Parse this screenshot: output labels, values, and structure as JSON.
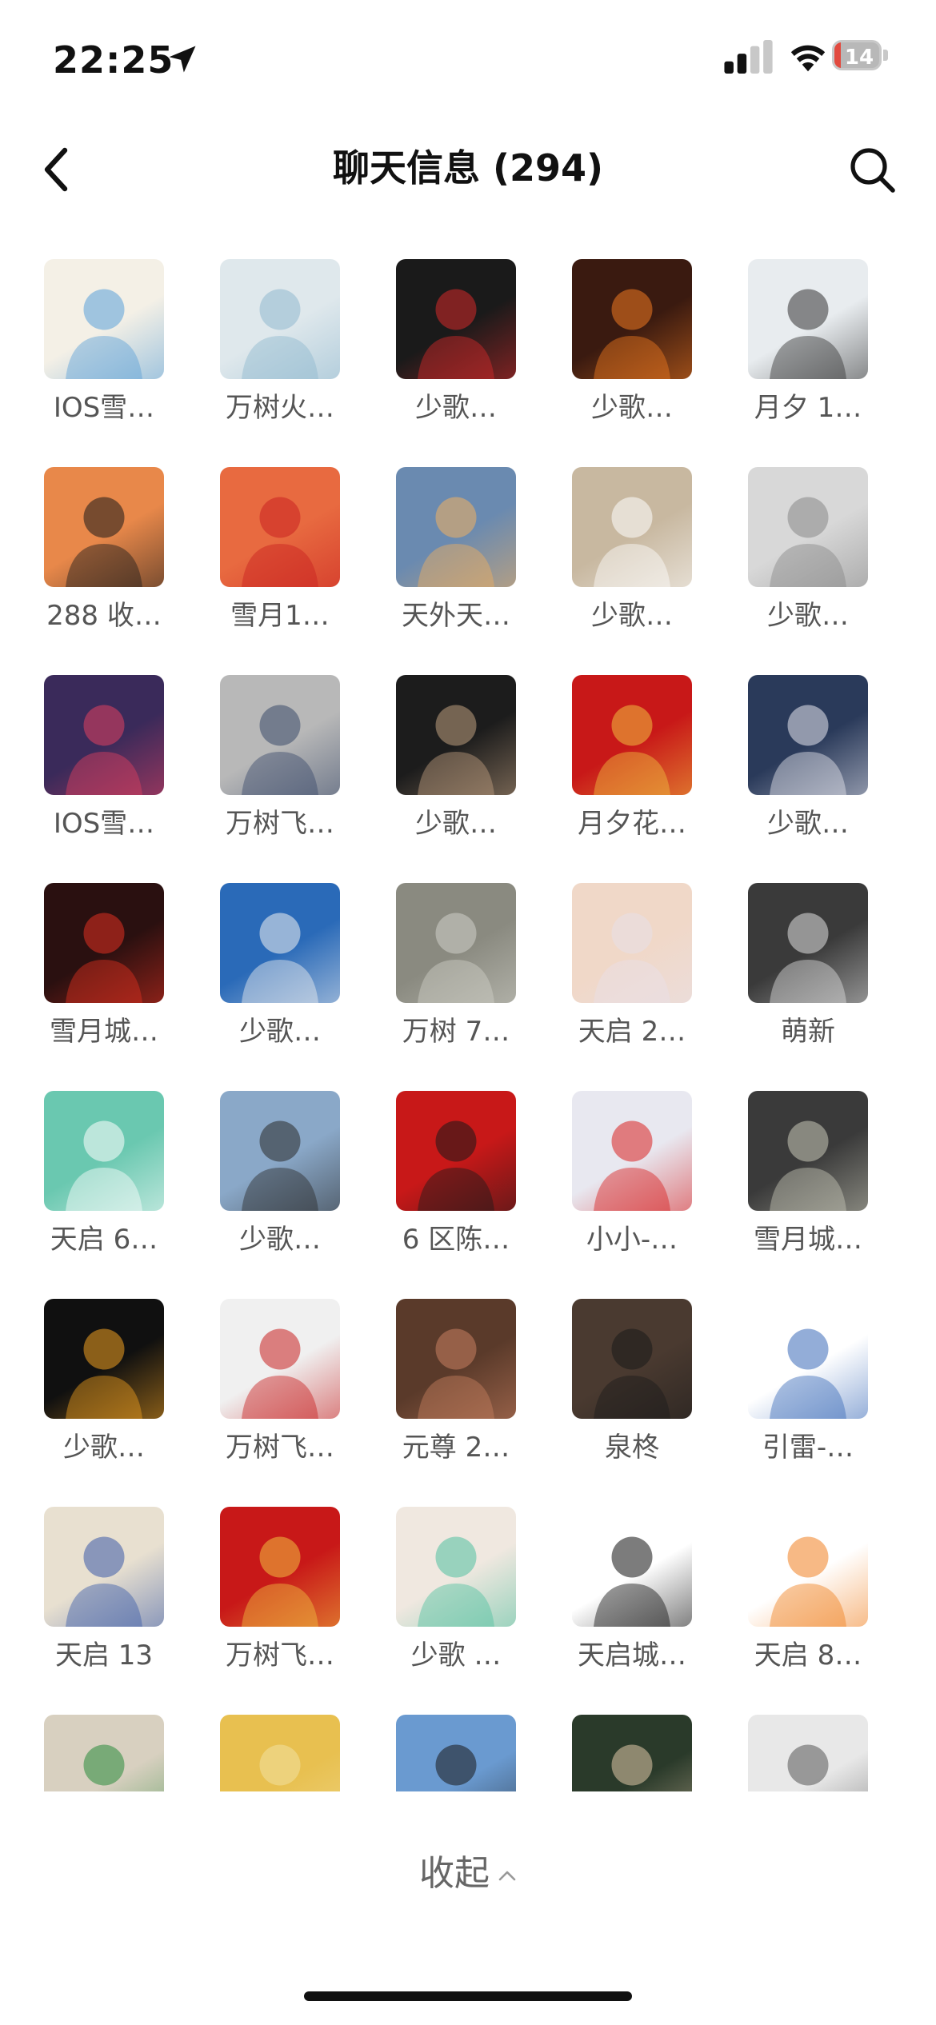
{
  "status": {
    "time": "22:25",
    "battery": "14",
    "battery_level": 0.14,
    "battery_color": "#e24a3f"
  },
  "nav": {
    "title": "聊天信息 (294)"
  },
  "members": [
    {
      "name": "IOS雪…",
      "color": "#f4f0e6",
      "accent": "#5aa0d8",
      "icon": "cartoon-avatar"
    },
    {
      "name": "万树火…",
      "color": "#dfe8ec",
      "accent": "#8fb8cf",
      "icon": "anime-avatar"
    },
    {
      "name": "少歌…",
      "color": "#1a1a1a",
      "accent": "#d62a2a",
      "icon": "mario-avatar"
    },
    {
      "name": "少歌…",
      "color": "#3a1a10",
      "accent": "#f07a20",
      "icon": "firework-avatar"
    },
    {
      "name": "月夕 1…",
      "color": "#e8ecef",
      "accent": "#333333",
      "icon": "photo-avatar"
    },
    {
      "name": "288 收…",
      "color": "#e8884a",
      "accent": "#1a1a1a",
      "icon": "fu-avatar"
    },
    {
      "name": "雪月1…",
      "color": "#e86a40",
      "accent": "#c82020",
      "icon": "cartoon-avatar"
    },
    {
      "name": "天外天…",
      "color": "#6a8ab0",
      "accent": "#f0b060",
      "icon": "photo-avatar"
    },
    {
      "name": "少歌…",
      "color": "#c8b8a0",
      "accent": "#ffffff",
      "icon": "photo-avatar"
    },
    {
      "name": "少歌…",
      "color": "#d8d8d8",
      "accent": "#888888",
      "icon": "sketch-avatar"
    },
    {
      "name": "IOS雪…",
      "color": "#3a2a5a",
      "accent": "#e04060",
      "icon": "anime-avatar"
    },
    {
      "name": "万树飞…",
      "color": "#b8b8b8",
      "accent": "#3a4a6a",
      "icon": "photo-avatar"
    },
    {
      "name": "少歌…",
      "color": "#1c1c1c",
      "accent": "#c0a080",
      "icon": "photo-avatar"
    },
    {
      "name": "月夕花…",
      "color": "#c81818",
      "accent": "#f0c040",
      "icon": "seal-avatar"
    },
    {
      "name": "少歌…",
      "color": "#2a3a5a",
      "accent": "#e8e8f0",
      "icon": "anime-avatar"
    },
    {
      "name": "雪月城…",
      "color": "#2a1010",
      "accent": "#e03020",
      "icon": "anime-avatar"
    },
    {
      "name": "少歌…",
      "color": "#2a6ab8",
      "accent": "#f0f0f0",
      "icon": "photo-avatar"
    },
    {
      "name": "万树 7…",
      "color": "#8a8a80",
      "accent": "#d0d0c8",
      "icon": "photo-avatar"
    },
    {
      "name": "天启 2…",
      "color": "#f0d8c8",
      "accent": "#e8e0e8",
      "icon": "anime-avatar"
    },
    {
      "name": "萌新",
      "color": "#3a3a3a",
      "accent": "#e0e0e0",
      "icon": "anime-avatar"
    },
    {
      "name": "天启 6…",
      "color": "#6ac8b0",
      "accent": "#ffffff",
      "icon": "text-avatar"
    },
    {
      "name": "少歌…",
      "color": "#8aa8c8",
      "accent": "#2a2a2a",
      "icon": "photo-avatar"
    },
    {
      "name": "6 区陈…",
      "color": "#c81818",
      "accent": "#1a1a1a",
      "icon": "cartoon-avatar"
    },
    {
      "name": "小小-…",
      "color": "#e8e8f0",
      "accent": "#d82020",
      "icon": "anime-avatar"
    },
    {
      "name": "雪月城…",
      "color": "#3a3a3a",
      "accent": "#c8c8b8",
      "icon": "jade-avatar"
    },
    {
      "name": "少歌…",
      "color": "#101010",
      "accent": "#f0a020",
      "icon": "smiley-avatar"
    },
    {
      "name": "万树飞…",
      "color": "#f0f0f0",
      "accent": "#c82020",
      "icon": "anime-avatar"
    },
    {
      "name": "元尊 2…",
      "color": "#5a3a2a",
      "accent": "#c88060",
      "icon": "anime-avatar"
    },
    {
      "name": "泉柊",
      "color": "#4a3a30",
      "accent": "#1a1a1a",
      "icon": "anime-avatar"
    },
    {
      "name": "引雷-…",
      "color": "#ffffff",
      "accent": "#3a6ab8",
      "icon": "cartoon-avatar"
    },
    {
      "name": "天启 13",
      "color": "#e8e0d0",
      "accent": "#3a5aa8",
      "icon": "cartoon-avatar"
    },
    {
      "name": "万树飞…",
      "color": "#c81818",
      "accent": "#f0c040",
      "icon": "text-avatar"
    },
    {
      "name": "少歌 …",
      "color": "#f0e8e0",
      "accent": "#50c0a0",
      "icon": "anime-avatar"
    },
    {
      "name": "天启城…",
      "color": "#ffffff",
      "accent": "#111111",
      "icon": "letter-avatar"
    },
    {
      "name": "天启 8…",
      "color": "#ffffff",
      "accent": "#f08020",
      "icon": "tiger-avatar"
    },
    {
      "name": "",
      "color": "#d8d0c0",
      "accent": "#2a8a3a",
      "icon": "photo-avatar"
    },
    {
      "name": "",
      "color": "#e8c050",
      "accent": "#f0e0a0",
      "icon": "photo-avatar"
    },
    {
      "name": "",
      "color": "#6a9ad0",
      "accent": "#1a1a1a",
      "icon": "photo-avatar"
    },
    {
      "name": "",
      "color": "#2a3a2a",
      "accent": "#e0c8a8",
      "icon": "photo-avatar"
    },
    {
      "name": "",
      "color": "#e8e8e8",
      "accent": "#555555",
      "icon": "raccoon-avatar"
    }
  ],
  "collapse": {
    "label": "收起"
  }
}
